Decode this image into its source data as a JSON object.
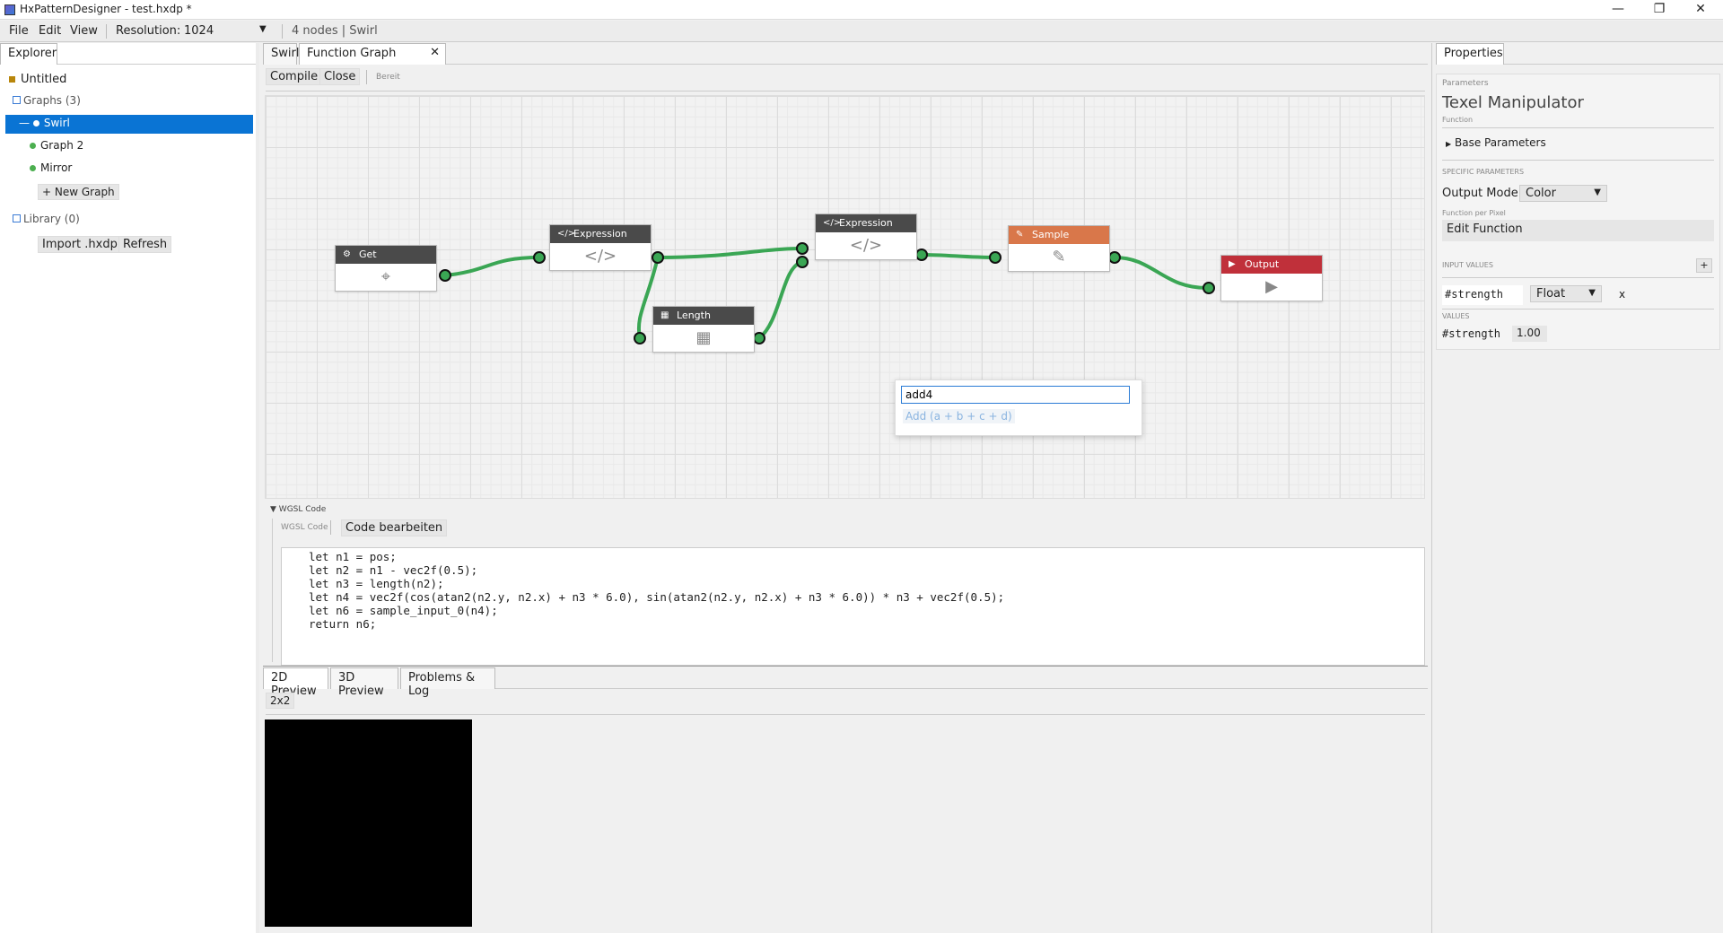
{
  "window": {
    "title": "HxPatternDesigner - test.hxdp *",
    "min": "—",
    "max": "❐",
    "close": "✕"
  },
  "menu": {
    "file": "File",
    "edit": "Edit",
    "view": "View",
    "resolution_label": "Resolution:",
    "resolution_value": "1024",
    "status": "4 nodes  |  Swirl"
  },
  "explorer": {
    "tab": "Explorer",
    "root": "Untitled",
    "graphs_label": "Graphs (3)",
    "graphs": [
      "Swirl",
      "Graph 2",
      "Mirror"
    ],
    "new_graph": "+ New Graph",
    "library_label": "Library (0)",
    "import": "Import .hxdp",
    "refresh": "Refresh"
  },
  "editor": {
    "tabs": [
      "Swirl",
      "Function Graph"
    ],
    "compile": "Compile",
    "close": "Close",
    "status": "Bereit"
  },
  "nodes": [
    {
      "id": "get",
      "title": "Get",
      "color": "#4a4a4a",
      "icon": "crosshair-icon",
      "glyph": "⌖"
    },
    {
      "id": "expr1",
      "title": "Expression",
      "color": "#4a4a4a",
      "icon": "code-icon",
      "glyph": "</>"
    },
    {
      "id": "length",
      "title": "Length",
      "color": "#4a4a4a",
      "icon": "calculator-icon",
      "glyph": "▦"
    },
    {
      "id": "expr2",
      "title": "Expression",
      "color": "#4a4a4a",
      "icon": "code-icon",
      "glyph": "</>"
    },
    {
      "id": "sample",
      "title": "Sample",
      "color": "#d9774a",
      "icon": "eyedropper-icon",
      "glyph": "✎"
    },
    {
      "id": "output",
      "title": "Output",
      "color": "#c0303a",
      "icon": "play-icon",
      "glyph": "▶"
    }
  ],
  "search_popup": {
    "value": "add4",
    "suggestion": "Add (a + b + c + d)"
  },
  "wgsl": {
    "section": "WGSL Code",
    "sub_label": "WGSL Code",
    "edit_button": "Code bearbeiten",
    "lines": [
      "let n1 = pos;",
      "let n2 = n1 - vec2f(0.5);",
      "let n3 = length(n2);",
      "let n4 = vec2f(cos(atan2(n2.y, n2.x) + n3 * 6.0), sin(atan2(n2.y, n2.x) + n3 * 6.0)) * n3 + vec2f(0.5);",
      "let n6 = sample_input_0(n4);",
      "return n6;"
    ]
  },
  "preview": {
    "tabs": [
      "2D Preview",
      "3D Preview",
      "Problems & Log"
    ],
    "size": "2x2"
  },
  "properties": {
    "tab": "Properties",
    "section": "Parameters",
    "title": "Texel Manipulator",
    "subtitle": "Function",
    "base_params": "Base Parameters",
    "specific": "SPECIFIC PARAMETERS",
    "output_mode_label": "Output Mode:",
    "output_mode_value": "Color",
    "fpp_label": "Function per Pixel",
    "edit_function": "Edit Function",
    "input_values": "INPUT VALUES",
    "add": "+",
    "input_name": "#strength",
    "input_type": "Float",
    "remove": "x",
    "values": "VALUES",
    "value_name": "#strength",
    "value": "1.00"
  },
  "colors": {
    "accent": "#0a74d4",
    "wire": "#3aa654",
    "port": "#3aa654"
  }
}
